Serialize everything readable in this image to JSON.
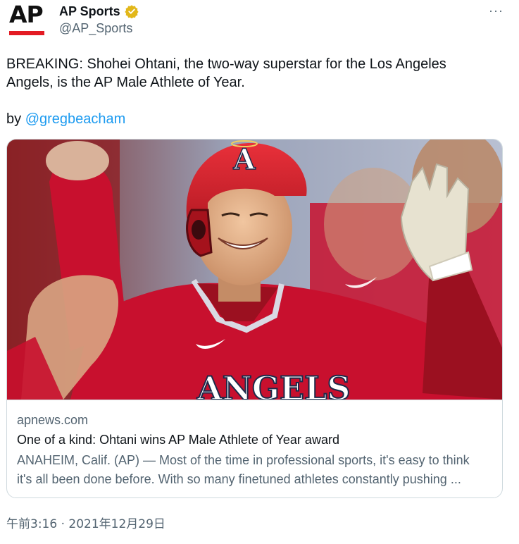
{
  "account": {
    "display_name": "AP Sports",
    "handle": "@AP_Sports",
    "logo_text": "AP",
    "verified_icon": "verified-badge-gold",
    "brand_color": "#e31b23"
  },
  "more_label": "···",
  "tweet": {
    "text": "BREAKING: Shohei Ohtani, the two-way superstar for the Los Angeles Angels, is the AP Male Athlete of Year.",
    "by_prefix": "by ",
    "mention": "@gregbeacham"
  },
  "card": {
    "jersey_text": "ANGELS",
    "helmet_logo": "A",
    "domain": "apnews.com",
    "title": "One of a kind: Ohtani wins AP Male Athlete of Year award",
    "description_line1": "ANAHEIM, Calif. (AP) — Most of the time in professional sports, it's easy to think",
    "description_line2": "it's all been done before. With so many finetuned athletes constantly pushing ..."
  },
  "timestamp": "午前3:16 · 2021年12月29日",
  "colors": {
    "link": "#1d9bf0",
    "secondary_text": "#536471",
    "angels_red": "#c8102e"
  }
}
